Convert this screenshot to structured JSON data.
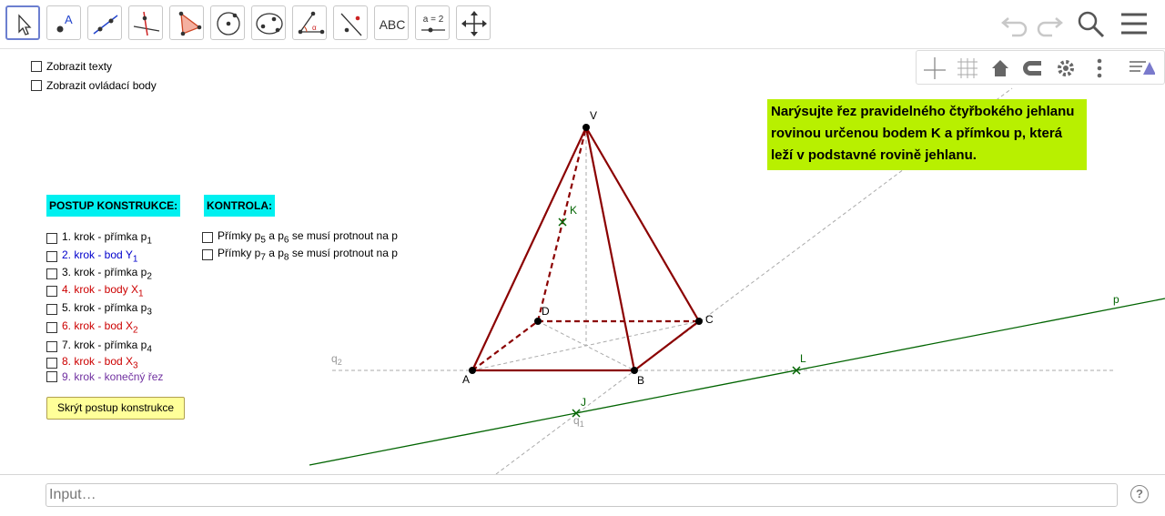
{
  "toolbar": {
    "tools": [
      {
        "name": "move-tool",
        "icon": "arrow-pointer-icon"
      },
      {
        "name": "point-tool",
        "icon": "point-icon",
        "label": "A"
      },
      {
        "name": "line-tool",
        "icon": "line-icon"
      },
      {
        "name": "perpendicular-tool",
        "icon": "perpendicular-icon"
      },
      {
        "name": "polygon-tool",
        "icon": "polygon-icon"
      },
      {
        "name": "circle-tool",
        "icon": "circle-icon"
      },
      {
        "name": "conic-tool",
        "icon": "conic-icon"
      },
      {
        "name": "angle-tool",
        "icon": "angle-icon"
      },
      {
        "name": "reflect-tool",
        "icon": "reflect-icon"
      },
      {
        "name": "text-tool",
        "icon": "text-icon",
        "label": "ABC"
      },
      {
        "name": "slider-tool",
        "icon": "slider-icon",
        "label": "a = 2"
      },
      {
        "name": "move-view-tool",
        "icon": "move-view-icon"
      }
    ],
    "right_icons": [
      "undo-icon",
      "redo-icon",
      "search-icon",
      "menu-icon"
    ]
  },
  "stylebar": {
    "icons": [
      "axes-icon",
      "grid-icon",
      "home-icon",
      "magnet-icon",
      "settings-icon",
      "more-icon",
      "style-toggle-icon"
    ]
  },
  "options": {
    "show_texts": "Zobrazit texty",
    "show_control_points": "Zobrazit ovládací body"
  },
  "construction": {
    "header": "POSTUP KONSTRUKCE:",
    "colors": {
      "black": "#000000",
      "blue": "#0000cc",
      "red": "#cc0000",
      "purple": "#7030a0"
    },
    "steps": [
      {
        "text": "1. krok - přímka p",
        "sub": "1",
        "color": "#000000"
      },
      {
        "text": "2. krok - bod Y",
        "sub": "1",
        "color": "#0000cc"
      },
      {
        "text": "3. krok - přímka p",
        "sub": "2",
        "color": "#000000"
      },
      {
        "text": "4. krok - body X",
        "sub": "1",
        "color": "#cc0000"
      },
      {
        "text": "5. krok - přímka p",
        "sub": "3",
        "color": "#000000"
      },
      {
        "text": "6. krok - bod X",
        "sub": "2",
        "color": "#cc0000"
      },
      {
        "text": "7. krok - přímka p",
        "sub": "4",
        "color": "#000000"
      },
      {
        "text": "8. krok - bod X",
        "sub": "3",
        "color": "#cc0000"
      },
      {
        "text": "9. krok - konečný řez",
        "sub": "",
        "color": "#7030a0"
      }
    ],
    "hide_button": "Skrýt postup konstrukce"
  },
  "control": {
    "header": "KONTROLA:",
    "items": [
      {
        "a": "Přímky p",
        "s1": "5",
        "b": " a p",
        "s2": "6",
        "c": " se musí protnout na p"
      },
      {
        "a": "Přímky p",
        "s1": "7",
        "b": " a p",
        "s2": "8",
        "c": " se musí protnout na p"
      }
    ]
  },
  "task": {
    "text": "Narýsujte řez pravidelného čtyřbokého jehlanu rovinou určenou bodem K a přímkou p, která leží v podstavné rovině jehlanu."
  },
  "figure": {
    "points": {
      "V": "V",
      "K": "K",
      "D": "D",
      "C": "C",
      "A": "A",
      "B": "B",
      "L": "L",
      "J": "J",
      "p": "p",
      "q2": "q",
      "q2_sub": "2",
      "q1": "q",
      "q1_sub": "1"
    },
    "colors": {
      "edge": "#8b0000",
      "line_p": "#006400",
      "helper": "#aaaaaa",
      "task_bg": "#b8f000",
      "header_bg": "#00f0f0"
    }
  },
  "input": {
    "placeholder": "Input…",
    "help": "?"
  }
}
